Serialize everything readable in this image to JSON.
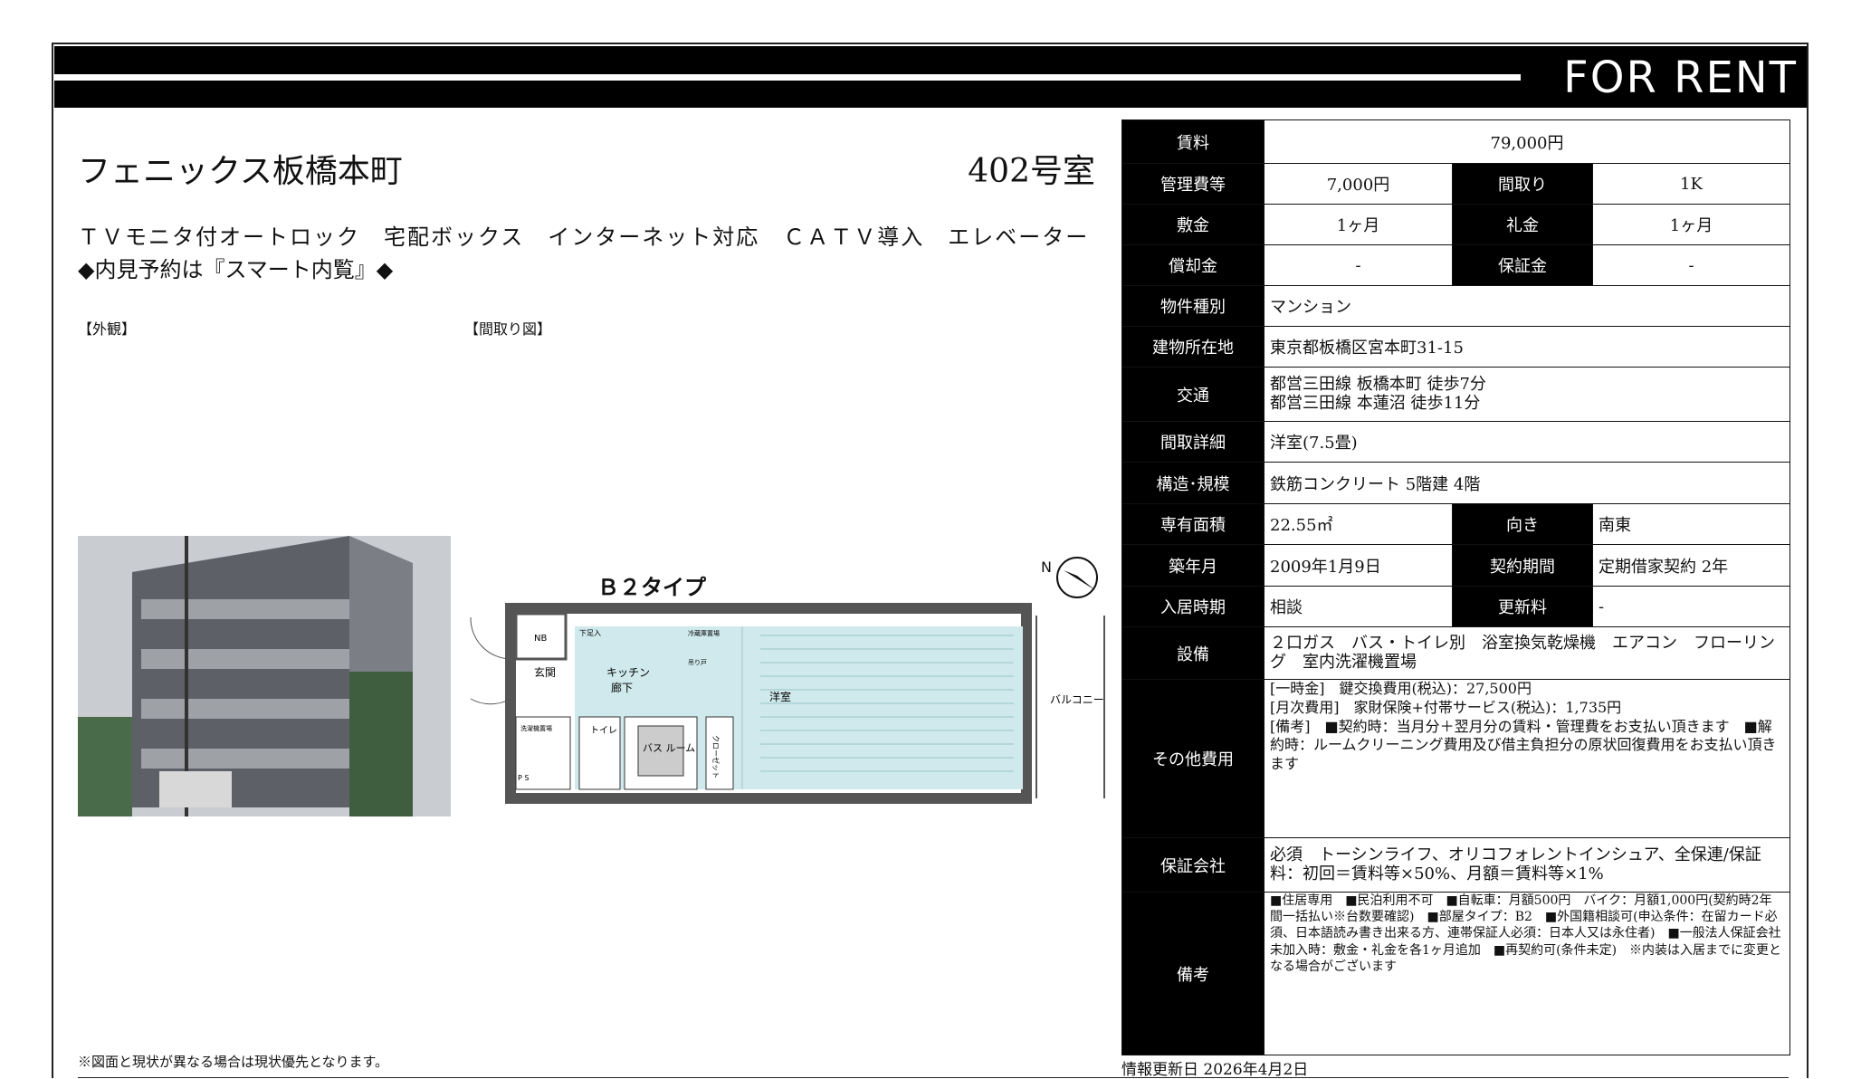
{
  "header": {
    "title": "FOR RENT"
  },
  "property": {
    "name": "フェニックス板橋本町",
    "room": "402号室",
    "features": "ＴＶモニタ付オートロック　宅配ボックス　インターネット対応　ＣＡＴＶ導入　エレベーター",
    "note": "◆内見予約は『スマート内覧』◆"
  },
  "images": {
    "exterior_label": "【外観】",
    "floorplan_label": "【間取り図】"
  },
  "floorplan": {
    "type": "Ｂ２タイプ",
    "rooms": [
      "洋室",
      "キッチン",
      "廊下",
      "玄関",
      "バス\nルーム",
      "トイレ",
      "クローゼット",
      "バルコニー",
      "洗濯機置場",
      "冷蔵庫置場",
      "吊り戸"
    ],
    "nb": "NB",
    "pd": "P S",
    "shoes": "下足入",
    "north": "N"
  },
  "disclaimer": "※図面と現状が異なる場合は現状優先となります。",
  "info": {
    "rent_label": "賃料",
    "rent": "79,000円",
    "mgmt_label": "管理費等",
    "mgmt": "7,000円",
    "layout_label": "間取り",
    "layout": "1K",
    "deposit_label": "敷金",
    "deposit": "1ヶ月",
    "keymoney_label": "礼金",
    "keymoney": "1ヶ月",
    "amort_label": "償却金",
    "amort": "-",
    "guarantee_label": "保証金",
    "guarantee": "-",
    "kind_label": "物件種別",
    "kind": "マンション",
    "address_label": "建物所在地",
    "address": "東京都板橋区宮本町31-15",
    "transit_label": "交通",
    "transit": "都営三田線 板橋本町 徒歩7分\n都営三田線 本蓮沼 徒歩11分",
    "detail_label": "間取詳細",
    "detail": "洋室(7.5畳)",
    "structure_label": "構造･規模",
    "structure": "鉄筋コンクリート 5階建 4階",
    "area_label": "専有面積",
    "area": "22.55㎡",
    "direction_label": "向き",
    "direction": "南東",
    "built_label": "築年月",
    "built": "2009年1月9日",
    "contract_label": "契約期間",
    "contract": "定期借家契約 2年",
    "movein_label": "入居時期",
    "movein": "相談",
    "renewal_label": "更新料",
    "renewal": "-",
    "equip_label": "設備",
    "equip": "２口ガス　バス・トイレ別　浴室換気乾燥機　エアコン　フローリング　室内洗濯機置場",
    "other_label": "その他費用",
    "other": "[一時金]　鍵交換費用(税込)：27,500円\n[月次費用]　家財保険+付帯サービス(税込)：1,735円\n[備考]　■契約時：当月分＋翌月分の賃料・管理費をお支払い頂きます　■解約時：ルームクリーニング費用及び借主負担分の原状回復費用をお支払い頂きます",
    "company_label": "保証会社",
    "company": "必須　トーシンライフ、オリコフォレントインシュア、全保連/保証料：初回＝賃料等×50%、月額＝賃料等×1%",
    "remarks_label": "備考",
    "remarks": "■住居専用　■民泊利用不可　■自転車：月額500円　バイク：月額1,000円(契約時2年間一括払い※台数要確認)　■部屋タイプ：B2　■外国籍相談可(申込条件：在留カード必須、日本語読み書き出来る方、連帯保証人必須：日本人又は永住者)　■一般法人保証会社未加入時：敷金・礼金を各1ヶ月追加　■再契約可(条件未定)　※内装は入居までに変更となる場合がございます"
  },
  "update": "情報更新日 2026年4月2日"
}
